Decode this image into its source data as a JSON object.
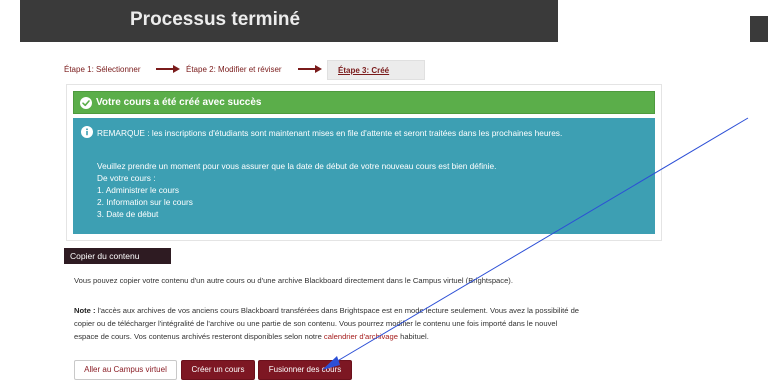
{
  "header": {
    "title": "Processus terminé"
  },
  "steps": {
    "step1": "Étape 1: Sélectionner",
    "step2": "Étape 2: Modifier et réviser",
    "step3": "Étape 3: Créé"
  },
  "success": {
    "message": "Votre cours a été créé avec succès"
  },
  "info": {
    "remark": "REMARQUE : les inscriptions d'étudiants sont maintenant mises en file d'attente et seront traitées dans les prochaines heures.",
    "line1": "Veuillez prendre un moment pour vous assurer que la date de début de votre nouveau cours est bien définie.",
    "line2": "De votre cours :",
    "items": [
      "1. Administrer le cours",
      "2. Information sur le cours",
      "3. Date de début"
    ]
  },
  "copy": {
    "title": "Copier du contenu",
    "intro": "Vous pouvez copier votre contenu d'un autre cours ou d'une archive Blackboard directement dans le Campus virtuel (Brightspace).",
    "note_label": "Note :",
    "note_line1": "l'accès aux archives de vos anciens cours Blackboard transférées dans Brightspace est en mode lecture seulement. Vous avez la possibilité de",
    "note_line2": "copier ou de télécharger l'intégralité de l'archive ou une partie de son contenu. Vous pourrez modifier le contenu une fois importé dans le nouvel",
    "note_line3_pre": "espace de cours. Vos contenus archivés resteront disponibles selon notre",
    "note_link": "calendrier d'archivage",
    "note_line3_post": "habituel."
  },
  "buttons": {
    "campus": "Aller au Campus virtuel",
    "create": "Créer un cours",
    "merge": "Fusionner des cours"
  },
  "colors": {
    "header_bg": "#3a3a3a",
    "success_green": "#5bae4a",
    "info_teal": "#3d9fb3",
    "brand_dark_red": "#7d1723",
    "annotation_blue": "#2c4fd6"
  }
}
